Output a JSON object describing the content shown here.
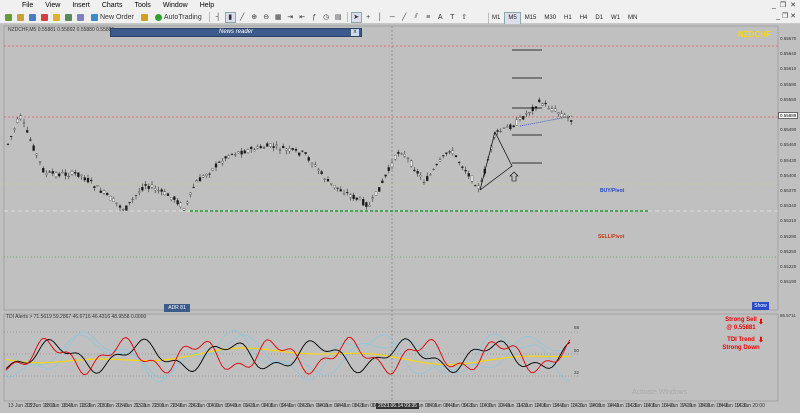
{
  "menu": [
    "File",
    "View",
    "Insert",
    "Charts",
    "Tools",
    "Window",
    "Help"
  ],
  "toolbar": {
    "new_order": "New Order",
    "autotrading": "AutoTrading",
    "timeframes": [
      "M1",
      "M5",
      "M15",
      "M30",
      "H1",
      "H4",
      "D1",
      "W1",
      "MN"
    ],
    "selected_timeframe": "M5"
  },
  "chart": {
    "symbol_header": "NZDCHF,M5  0.55881 0.55892 0.55880 0.55889",
    "symbol_top_right": "NZDCHF",
    "news_panel_title": "News reader",
    "news_close": "x",
    "buy_pivot": "BUY/Pivot",
    "sell_pivot": "SELL/Pivot",
    "adr_button": "ADR 81",
    "show_button": "Show",
    "watermark": "Activate Windows",
    "current_price": "0.55889",
    "colors": {
      "chart_bg": "#c0c0c0",
      "candle": "#1a1a1a",
      "buy_line": "#1e9e2e",
      "red_dash": "#e03030",
      "tdi_price": "#e00000",
      "tdi_signal": "#000000",
      "tdi_market_base": "#ffd700",
      "tdi_bands": "#7fc8e8"
    }
  },
  "price_axis": [
    "0.55670",
    "0.55640",
    "0.55610",
    "0.55580",
    "0.55550",
    "0.55520",
    "0.55490",
    "0.55460",
    "0.55430",
    "0.55400",
    "0.55370",
    "0.55340",
    "0.55310",
    "0.55280",
    "0.55250",
    "0.55220",
    "0.55190"
  ],
  "indicator": {
    "header": "TDI Alerts > 71.5619 59.2867 46.6716 46.4316 48.9558 0.0000",
    "level_top": "86.5711",
    "levels": [
      "68",
      "50",
      "32"
    ],
    "strong_sell_line1": "Strong Sell",
    "strong_sell_line2": "@ 0.55881",
    "trend_line1": "TDI Trend",
    "trend_line2": "Strong Down"
  },
  "time_axis": [
    "13 Jun 2023",
    "13 Jun 18:00",
    "13 Jun 18:40",
    "13 Jun 19:20",
    "13 Jun 20:00",
    "13 Jun 20:40",
    "13 Jun 21:20",
    "13 Jun 22:00",
    "13 Jun 22:40",
    "13 Jun 23:20",
    "14 Jun 00:00",
    "14 Jun 00:40",
    "14 Jun 01:20",
    "14 Jun 02:00",
    "14 Jun 02:40",
    "14 Jun 03:20",
    "14 Jun 04:00",
    "14 Jun 04:40",
    "14 Jun 05:20",
    "14 Jun 06:00",
    "14 Jun 06:40",
    "14 Jun 07:20",
    "14 Jun 08:00",
    "14 Jun 08:40",
    "14 Jun 09:20",
    "14 Jun 10:00",
    "14 Jun 10:40",
    "14 Jun 11:20",
    "14 Jun 12:00",
    "14 Jun 12:40",
    "14 Jun 13:20",
    "14 Jun 14:00",
    "14 Jun 14:40",
    "14 Jun 15:20",
    "14 Jun 16:00",
    "14 Jun 16:40",
    "14 Jun 17:20",
    "14 Jun 18:00",
    "14 Jun 18:40",
    "14 Jun 19:20",
    "14 Jun 20:00"
  ],
  "time_highlight": "2023.06.14 09:35"
}
